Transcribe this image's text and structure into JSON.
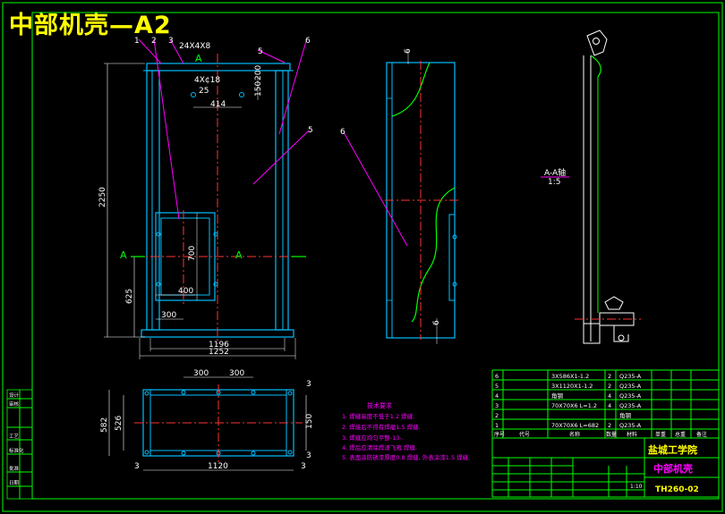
{
  "title": "中部机壳—A2",
  "front_view": {
    "dims": {
      "top_bar": "24X4X8",
      "top_holes": "4X¢18",
      "h_150": "150",
      "h_200": "200",
      "h_414": "414",
      "h_2250": "2250",
      "h_700": "700",
      "h_625": "625",
      "h_400": "400",
      "h_300": "300",
      "h_1196": "1196",
      "h_1252": "1252",
      "weld": "5",
      "r_25": "25"
    },
    "section_label": "A",
    "parts": [
      "1",
      "2",
      "3",
      "5",
      "6"
    ]
  },
  "side_view": {
    "dims": {
      "top_6": "6",
      "bot_6": "6"
    },
    "parts": [
      "6"
    ]
  },
  "section_view": {
    "label_line1": "A-A轴",
    "label_line2": "1:5"
  },
  "bottom_view": {
    "dims": {
      "d300a": "300",
      "d300b": "300",
      "d1120": "1120",
      "d582": "582",
      "d526": "526",
      "d150": "150",
      "d3a": "3",
      "d3b": "3",
      "d3c": "3",
      "d3d": "3"
    }
  },
  "notes": {
    "title": "技术要求",
    "items": [
      "1. 焊缝高度不低于1.2 焊缝.",
      "2. 焊接后不得有焊瘤1.5 焊缝.",
      "3. 焊缝应均匀平整-13-.",
      "4. 焊后应清除焊渣飞溅 焊缝.",
      "5. 表面涂防锈漆厚度0.8 焊缝, 外表涂漆1.5 焊缝."
    ]
  },
  "bom": {
    "rows": [
      {
        "no": "6",
        "name": "3X586X1-1.2",
        "qty": "2",
        "material": "Q235-A"
      },
      {
        "no": "5",
        "name": "3X1120X1-1.2",
        "qty": "2",
        "material": "Q235-A"
      },
      {
        "no": "4",
        "name": "角钢",
        "qty": "4",
        "material": "Q235-A"
      },
      {
        "no": "3",
        "name": "70X70X6 L=1.2",
        "qty": "4",
        "material": "Q235-A"
      },
      {
        "no": "2",
        "name": "",
        "qty": "",
        "material": "角钢"
      },
      {
        "no": "1",
        "name": "70X70X6 L=682",
        "qty": "2",
        "material": "Q235-A"
      }
    ],
    "header": [
      "序号",
      "代号",
      "名称",
      "数量",
      "材料",
      "单重",
      "总重",
      "备注"
    ]
  },
  "title_block": {
    "school": "盐城工学院",
    "part_name": "中部机壳",
    "drawing_no": "TH260-02",
    "scale": "1:10",
    "left_labels": [
      "设计",
      "审核",
      "",
      "工艺",
      "标准化",
      "批准",
      "日期"
    ]
  },
  "colors": {
    "background": "#000000",
    "outline": "#00ff00",
    "body": "#00bfff",
    "leader": "#ff00ff",
    "centerline": "#ff3333",
    "text": "#ffffff",
    "title": "#ffff00"
  }
}
